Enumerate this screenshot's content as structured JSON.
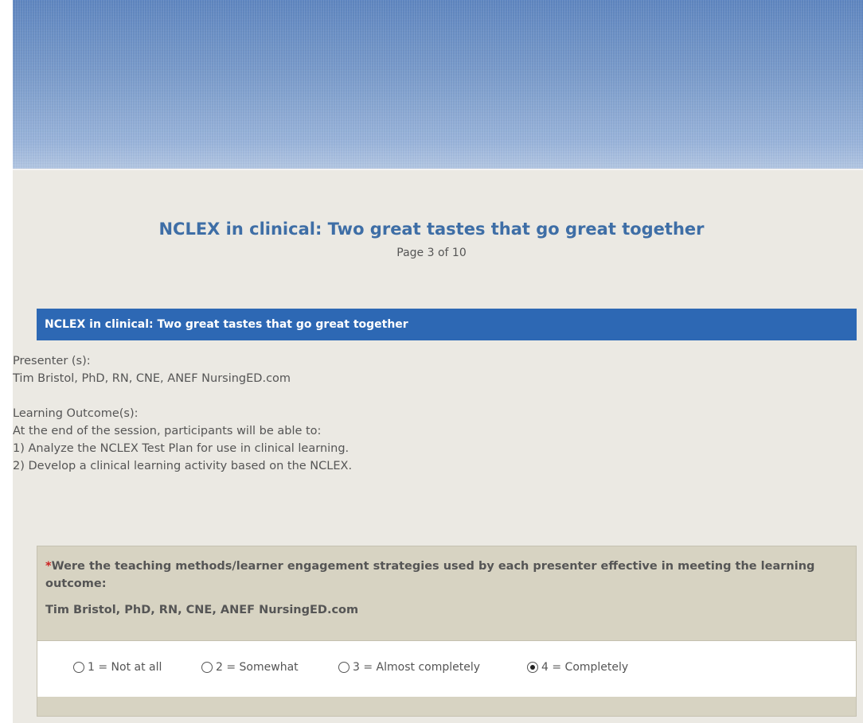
{
  "survey": {
    "title": "NCLEX in clinical: Two great tastes that go great together",
    "page_indicator": "Page 3 of 10"
  },
  "section": {
    "header": "NCLEX in clinical: Two great tastes that go great together",
    "presenter_label": "Presenter (s):",
    "presenter_value": "Tim Bristol, PhD, RN, CNE, ANEF NursingED.com",
    "outcomes_label": "Learning Outcome(s):",
    "outcomes_intro": "At the end of the session, participants will be able to:",
    "outcomes": [
      "1) Analyze the NCLEX Test Plan for use in clinical learning.",
      "2) Develop a clinical learning activity based on the NCLEX."
    ]
  },
  "question": {
    "required_marker": "*",
    "text": "Were the teaching methods/learner engagement strategies used by each presenter effective in meeting the learning outcome:",
    "presenter": "Tim Bristol, PhD, RN, CNE, ANEF NursingED.com",
    "options": [
      {
        "label": "1 = Not at all",
        "selected": false
      },
      {
        "label": "2 = Somewhat",
        "selected": false
      },
      {
        "label": "3 = Almost completely",
        "selected": false
      },
      {
        "label": "4 = Completely",
        "selected": true
      }
    ]
  }
}
